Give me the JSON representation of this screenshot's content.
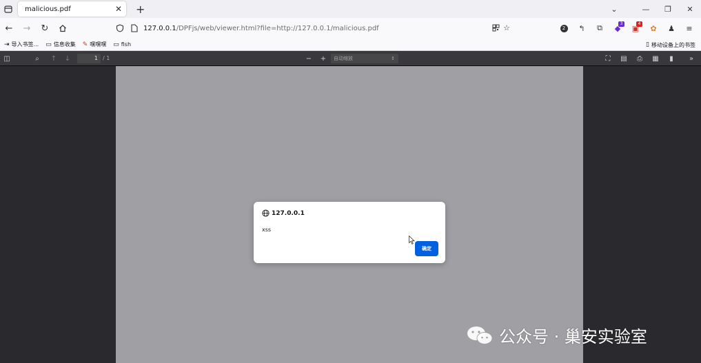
{
  "tab": {
    "title": "malicious.pdf"
  },
  "address": {
    "host": "127.0.0.1",
    "rest": "/DPFjs/web/viewer.html?file=http://127.0.0.1/malicious.pdf"
  },
  "extensions": [
    {
      "icon": "translate-icon",
      "badge": ""
    },
    {
      "icon": "back-arrow-icon",
      "badge": ""
    },
    {
      "icon": "puzzle-icon",
      "badge": ""
    },
    {
      "icon": "shield-icon",
      "badge": "3"
    },
    {
      "icon": "calendar-icon",
      "badge": "4"
    },
    {
      "icon": "fox-icon",
      "badge": ""
    },
    {
      "icon": "person-icon",
      "badge": ""
    }
  ],
  "bookmarks": [
    {
      "icon": "import-icon",
      "label": "导入书签..."
    },
    {
      "icon": "folder-icon",
      "label": "信息收集"
    },
    {
      "icon": "app-icon",
      "label": "嘿嘿嘿"
    },
    {
      "icon": "folder-icon",
      "label": "fish"
    }
  ],
  "mobile_bookmarks": "移动设备上的书签",
  "pdf": {
    "page": "1",
    "page_count": "/ 1",
    "zoom": "自动缩放"
  },
  "dialog": {
    "origin": "127.0.0.1",
    "message": "xss",
    "ok": "确定"
  },
  "watermark": {
    "text": "公众号 · 巢安实验室"
  },
  "colors": {
    "accent": "#0061e0",
    "pdf_toolbar": "#38383d",
    "page_bg": "#a09fa4"
  }
}
